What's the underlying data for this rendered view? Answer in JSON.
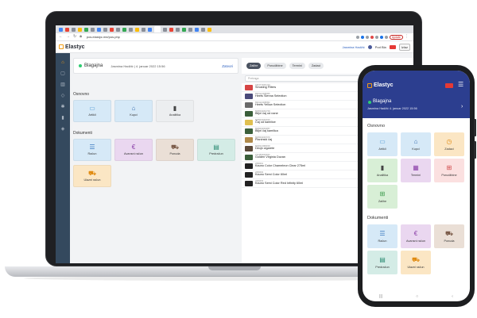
{
  "desktop": {
    "url": "pos.elastyc.me/pos.php",
    "logo": "Elastyc",
    "header": {
      "user": "Jasmina Hadžić",
      "branch": "Pod Bla",
      "logout": "Izlaz",
      "update": "Update"
    },
    "panel": {
      "title": "Blagajna",
      "subtitle": "Jasmina Hadžić | 4. januar 2022 15:56",
      "close": "Zatvori"
    },
    "sections": {
      "basic": "Osnovno",
      "documents": "Dokumenti"
    },
    "basic_tiles": [
      {
        "label": "Artikli",
        "icon": "folder-icon"
      },
      {
        "label": "Kupci",
        "icon": "building-icon"
      },
      {
        "label": "Analitika",
        "icon": "bar-chart-icon"
      }
    ],
    "doc_tiles": [
      {
        "label": "Račun",
        "icon": "receipt-icon"
      },
      {
        "label": "Avansni račun",
        "icon": "euro-icon"
      },
      {
        "label": "Ponuda",
        "icon": "cart-icon"
      },
      {
        "label": "Predračun",
        "icon": "document-icon"
      },
      {
        "label": "Ulazni račun",
        "icon": "basket-icon"
      }
    ],
    "filters": [
      "Zalihe",
      "Porudžbine",
      "Termini",
      "Zadaci"
    ],
    "search_placeholder": "Pretraga",
    "products": [
      {
        "code": "0443773001234",
        "name": "Smoking Filters"
      },
      {
        "code": "8901121008355",
        "name": "Heets Sienna Selection"
      },
      {
        "code": "8901121008352",
        "name": "Heets Yellow Selection"
      },
      {
        "code": "8605032002700",
        "name": "Biljni čaj od nane"
      },
      {
        "code": "8605032004602",
        "name": "Čaj od kamilice"
      },
      {
        "code": "8605032004857",
        "name": "Biljni čaj kamilica"
      },
      {
        "code": "8605032007070",
        "name": "Planinski čaj"
      },
      {
        "code": "8606021880000",
        "name": "Džojn cigarete"
      },
      {
        "code": "0713593000031",
        "name": "Golden Virginia Duvan"
      },
      {
        "code": "2066001",
        "name": "Kauno Color Chameleon Clear 275ml"
      },
      {
        "code": "2066002",
        "name": "Kauno Semi Color 60ml"
      },
      {
        "code": "2066003",
        "name": "Kauno Semi Color Red Infinity 60ml"
      }
    ]
  },
  "mobile": {
    "logo": "Elastyc",
    "title": "Blagajna",
    "subtitle": "Jasmina Hadžić 4. januar 2022 15:56",
    "sections": {
      "basic": "Osnovno",
      "documents": "Dokumenti"
    },
    "basic_tiles": [
      {
        "label": "Artikli",
        "icon": "folder-icon"
      },
      {
        "label": "Kupci",
        "icon": "building-icon"
      },
      {
        "label": "Zadaci",
        "icon": "clock-icon"
      },
      {
        "label": "Analitika",
        "icon": "bar-chart-icon"
      },
      {
        "label": "Termini",
        "icon": "calendar-icon"
      },
      {
        "label": "Porudžbine",
        "icon": "sitemap-icon"
      },
      {
        "label": "Zalihe",
        "icon": "sitemap-icon"
      }
    ],
    "doc_tiles": [
      {
        "label": "Račun",
        "icon": "receipt-icon"
      },
      {
        "label": "Avansni račun",
        "icon": "euro-icon"
      },
      {
        "label": "Ponuda",
        "icon": "cart-icon"
      },
      {
        "label": "Predračun",
        "icon": "document-icon"
      },
      {
        "label": "Ulazni račun",
        "icon": "basket-icon"
      }
    ]
  },
  "colors": {
    "brand": "#f39c12",
    "sidebar": "#34495e",
    "mobile_header": "#2c3e8f",
    "tile_blue": "#d6e9f7",
    "tile_purple": "#ead7f0",
    "tile_beige": "#eadfd6",
    "tile_teal": "#d4ece6",
    "tile_yellow": "#fbe6c4",
    "tile_green": "#d8efd6",
    "tile_grey": "#eceef0"
  }
}
